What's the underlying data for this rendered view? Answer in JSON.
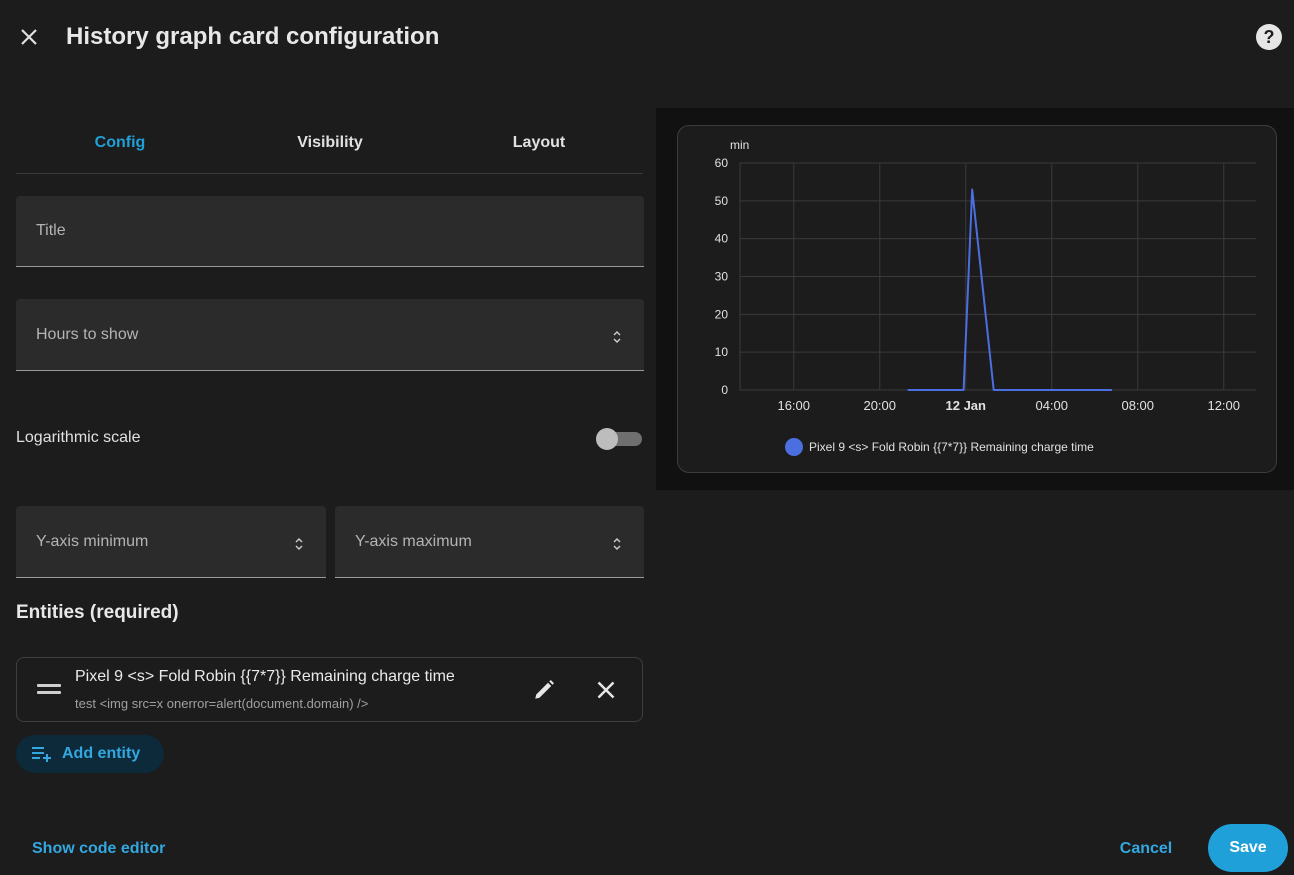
{
  "header": {
    "title": "History graph card configuration",
    "help_label": "?"
  },
  "tabs": [
    {
      "label": "Config",
      "active": true
    },
    {
      "label": "Visibility",
      "active": false
    },
    {
      "label": "Layout",
      "active": false
    }
  ],
  "form": {
    "title_label": "Title",
    "hours_label": "Hours to show",
    "log_scale_label": "Logarithmic scale",
    "log_scale_on": false,
    "ymin_label": "Y-axis minimum",
    "ymax_label": "Y-axis maximum",
    "entities_heading": "Entities (required)"
  },
  "entities": [
    {
      "name": "Pixel 9 <s> Fold Robin {{7*7}} Remaining charge time",
      "secondary": "test <img src=x onerror=alert(document.domain) />"
    }
  ],
  "add_entity_label": "Add entity",
  "footer": {
    "show_code_label": "Show code editor",
    "cancel_label": "Cancel",
    "save_label": "Save"
  },
  "colors": {
    "accent": "#1fa0d8",
    "series": "#4b6fe0",
    "background": "#1c1c1c"
  },
  "icons": {
    "close": "close-icon",
    "help": "help-icon",
    "drag": "drag-handle-icon",
    "edit": "pencil-icon",
    "remove": "close-icon",
    "add": "playlist-plus-icon",
    "spin": "spin-arrows-icon"
  },
  "chart_data": {
    "type": "line",
    "unit_label": "min",
    "y_ticks": [
      0,
      10,
      20,
      30,
      40,
      50,
      60
    ],
    "ylim": [
      0,
      60
    ],
    "x_ticks": [
      "16:00",
      "20:00",
      "12 Jan",
      "04:00",
      "08:00",
      "12:00"
    ],
    "bold_x_tick": "12 Jan",
    "x_hours": [
      16,
      20,
      24,
      28,
      32,
      36
    ],
    "xlim_hours": [
      13.5,
      37.5
    ],
    "grid": true,
    "legend_position": "bottom-center",
    "series": [
      {
        "name": "Pixel 9 <s> Fold Robin {{7*7}} Remaining charge time",
        "points": [
          [
            21.3,
            0
          ],
          [
            23.9,
            0
          ],
          [
            24.3,
            53
          ],
          [
            25.3,
            0
          ],
          [
            30.8,
            0
          ]
        ]
      }
    ]
  }
}
